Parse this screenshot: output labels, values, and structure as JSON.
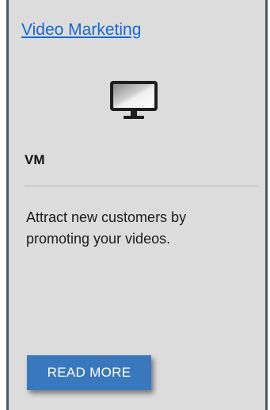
{
  "card": {
    "title_link": "Video Marketing",
    "icon": "monitor-icon",
    "code": "VM",
    "description": "Attract new customers by promoting your videos.",
    "button_label": "READ MORE"
  },
  "colors": {
    "card_background": "#dcdcdc",
    "link": "#1a66d4",
    "button": "#3a78be",
    "border": "#4a5a6e"
  }
}
